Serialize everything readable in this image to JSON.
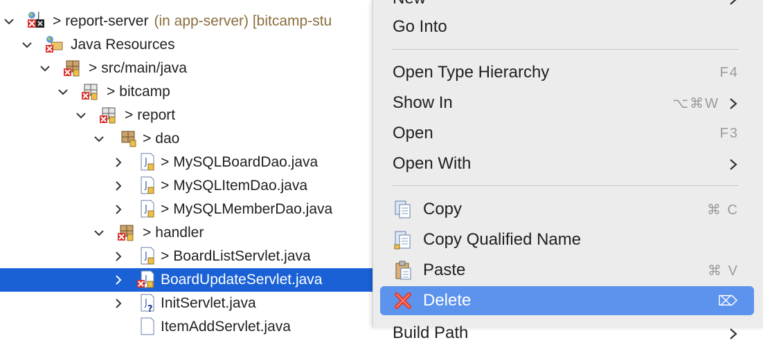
{
  "tree": {
    "rows": [
      {
        "label": "report-server",
        "decor": "(in app-server) [bitcamp-stu",
        "dirty": ">",
        "expanded": true,
        "icon": "java-project-icon"
      },
      {
        "label": "Java Resources",
        "decor": "",
        "dirty": "",
        "expanded": true,
        "icon": "java-resources-icon"
      },
      {
        "label": "src/main/java",
        "decor": "",
        "dirty": ">",
        "expanded": true,
        "icon": "source-folder-icon"
      },
      {
        "label": "bitcamp",
        "decor": "",
        "dirty": ">",
        "expanded": true,
        "icon": "package-icon"
      },
      {
        "label": "report",
        "decor": "",
        "dirty": ">",
        "expanded": true,
        "icon": "package-icon"
      },
      {
        "label": "dao",
        "decor": "",
        "dirty": ">",
        "expanded": true,
        "icon": "package-icon"
      },
      {
        "label": "MySQLBoardDao.java",
        "decor": "",
        "dirty": ">",
        "expanded": false,
        "icon": "java-file-icon"
      },
      {
        "label": "MySQLItemDao.java",
        "decor": "",
        "dirty": ">",
        "expanded": false,
        "icon": "java-file-icon"
      },
      {
        "label": "MySQLMemberDao.java",
        "decor": "",
        "dirty": ">",
        "expanded": false,
        "icon": "java-file-icon"
      },
      {
        "label": "handler",
        "decor": "",
        "dirty": ">",
        "expanded": true,
        "icon": "package-icon"
      },
      {
        "label": "BoardListServlet.java",
        "decor": "",
        "dirty": ">",
        "expanded": false,
        "icon": "java-file-icon"
      },
      {
        "label": "BoardUpdateServlet.java",
        "decor": "",
        "dirty": "",
        "expanded": false,
        "icon": "java-file-error-icon",
        "selected": true
      },
      {
        "label": "InitServlet.java",
        "decor": "",
        "dirty": "",
        "expanded": false,
        "icon": "java-file-unknown-icon"
      },
      {
        "label": "ItemAddServlet.java",
        "decor": "",
        "dirty": "",
        "expanded": false,
        "icon": "java-file-icon"
      }
    ]
  },
  "menu": {
    "items": [
      {
        "label": "New",
        "shortcut": "",
        "submenu": true
      },
      {
        "label": "Go Into",
        "shortcut": "",
        "submenu": false
      },
      {
        "label": "Open Type Hierarchy",
        "shortcut": "F4",
        "submenu": false
      },
      {
        "label": "Show In",
        "shortcut": "⌥⌘W",
        "submenu": true
      },
      {
        "label": "Open",
        "shortcut": "F3",
        "submenu": false
      },
      {
        "label": "Open With",
        "shortcut": "",
        "submenu": true
      },
      {
        "label": "Copy",
        "shortcut": "⌘ C",
        "submenu": false,
        "icon": "copy-icon"
      },
      {
        "label": "Copy Qualified Name",
        "shortcut": "",
        "submenu": false,
        "icon": "copy-qualified-name-icon"
      },
      {
        "label": "Paste",
        "shortcut": "⌘ V",
        "submenu": false,
        "icon": "paste-icon"
      },
      {
        "label": "Delete",
        "shortcut": "⌦",
        "submenu": false,
        "icon": "delete-icon",
        "active": true
      },
      {
        "label": "Build Path",
        "shortcut": "",
        "submenu": true
      }
    ]
  },
  "colors": {
    "selection": "#1a61d6",
    "menu_highlight": "#5c93ec",
    "menu_bg": "#ececec",
    "decoration": "#8a6d3b",
    "error": "#d9302c"
  }
}
